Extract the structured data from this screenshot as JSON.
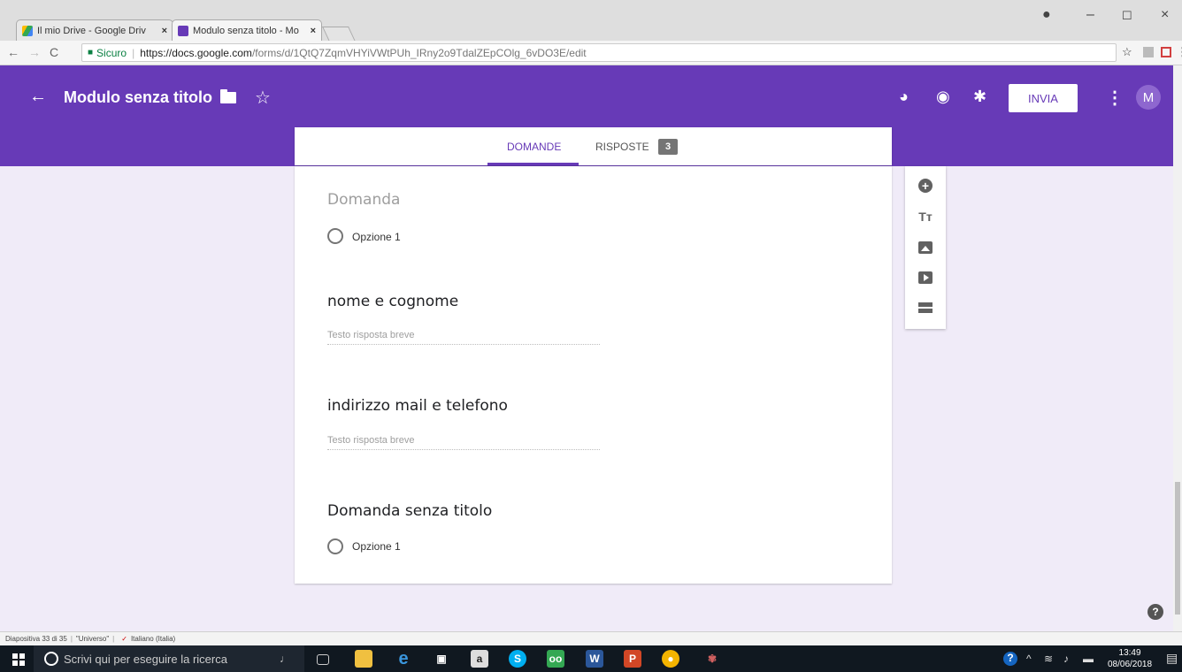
{
  "browser": {
    "tabs": [
      {
        "label": "Il mio Drive - Google Driv",
        "active": false,
        "favicon": "drive-icon"
      },
      {
        "label": "Modulo senza titolo - Mo",
        "active": true,
        "favicon": "forms-icon"
      }
    ],
    "address": {
      "secure_label": "Sicuro",
      "url_host": "https://docs.google.com",
      "url_path": "/forms/d/1QtQ7ZqmVHYiVWtPUh_IRny2o9TdalZEpCOlg_6vDO3E/edit"
    }
  },
  "header": {
    "back_icon": "←",
    "title": "Modulo senza titolo",
    "send_label": "INVIA",
    "avatar_letter": "M",
    "accent_color": "#673ab7"
  },
  "tabs": {
    "questions": "DOMANDE",
    "responses": "RISPOSTE",
    "response_count": "3"
  },
  "questions": [
    {
      "title": "Domanda",
      "type": "multiple_choice",
      "option": "Opzione 1"
    },
    {
      "title": "nome e cognome",
      "type": "short_answer",
      "placeholder": "Testo risposta breve"
    },
    {
      "title": "indirizzo mail e telefono",
      "type": "short_answer",
      "placeholder": "Testo risposta breve"
    },
    {
      "title": "Domanda senza titolo",
      "type": "multiple_choice",
      "option": "Opzione 1"
    }
  ],
  "toolbar": {
    "title_glyph": "Tт"
  },
  "help_glyph": "?",
  "statusbar": {
    "slide": "Diapositiva 33 di 35",
    "theme": "\"Universo\"",
    "language": "Italiano (Italia)"
  },
  "taskbar": {
    "search_placeholder": "Scrivi qui per eseguire la ricerca",
    "time": "13:49",
    "date": "08/06/2018"
  }
}
